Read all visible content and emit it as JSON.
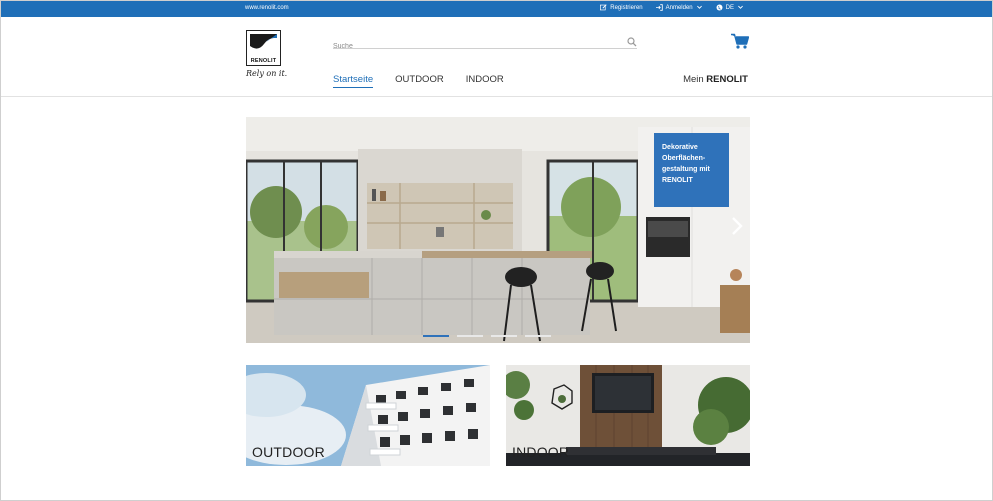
{
  "topbar": {
    "url": "www.renolit.com",
    "links": [
      {
        "label": "Registrieren",
        "icon": "edit-icon"
      },
      {
        "label": "Anmelden",
        "icon": "sign-in-icon"
      },
      {
        "label": "DE",
        "icon": "globe-icon"
      }
    ]
  },
  "header": {
    "logo_word": "RENOLIT",
    "slogan": "Rely on it.",
    "search_placeholder": "Suche",
    "nav": [
      {
        "label": "Startseite",
        "active": true
      },
      {
        "label": "OUTDOOR",
        "active": false
      },
      {
        "label": "INDOOR",
        "active": false
      }
    ],
    "account_prefix": "Mein",
    "account_brand": "RENOLIT"
  },
  "hero": {
    "promo_line1": "Dekorative",
    "promo_line2": "Oberflächen-",
    "promo_line3": "gestaltung mit",
    "promo_brand": "RENOLIT",
    "slides": 4,
    "active_slide": 0
  },
  "tiles": {
    "outdoor_label": "OUTDOOR",
    "indoor_label": "INDOOR"
  },
  "colors": {
    "brand_blue": "#1f6fb8",
    "promo_blue": "#2f72ba"
  }
}
